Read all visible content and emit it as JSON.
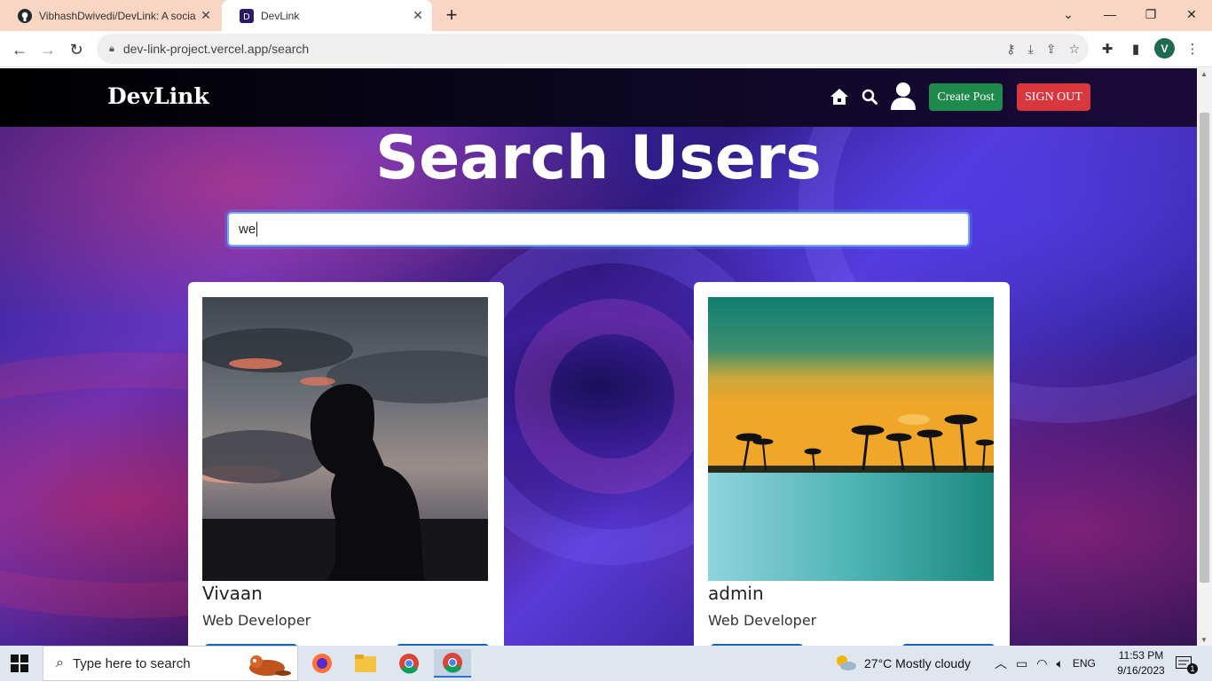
{
  "browser": {
    "tabs": [
      {
        "title": "VibhashDwivedi/DevLink: A socia",
        "icon": "github-icon",
        "active": false
      },
      {
        "title": "DevLink",
        "icon": "devlink-favicon",
        "active": true
      }
    ],
    "url": "dev-link-project.vercel.app/search",
    "profile_initial": "V"
  },
  "app": {
    "brand": "DevLink",
    "nav": {
      "create_post": "Create Post",
      "sign_out": "SIGN OUT"
    },
    "page_title": "Search Users",
    "search": {
      "value": "we"
    },
    "results": [
      {
        "name": "Vivaan",
        "role": "Web Developer",
        "photo": "silhouette-sunset"
      },
      {
        "name": "admin",
        "role": "Web Developer",
        "photo": "tropical-beach"
      }
    ],
    "colors": {
      "create_post": "#1e8a4c",
      "sign_out": "#d9363e"
    }
  },
  "taskbar": {
    "search_placeholder": "Type here to search",
    "weather": "27°C  Mostly cloudy",
    "language": "ENG",
    "time": "11:53 PM",
    "date": "9/16/2023",
    "notifications": "1"
  }
}
